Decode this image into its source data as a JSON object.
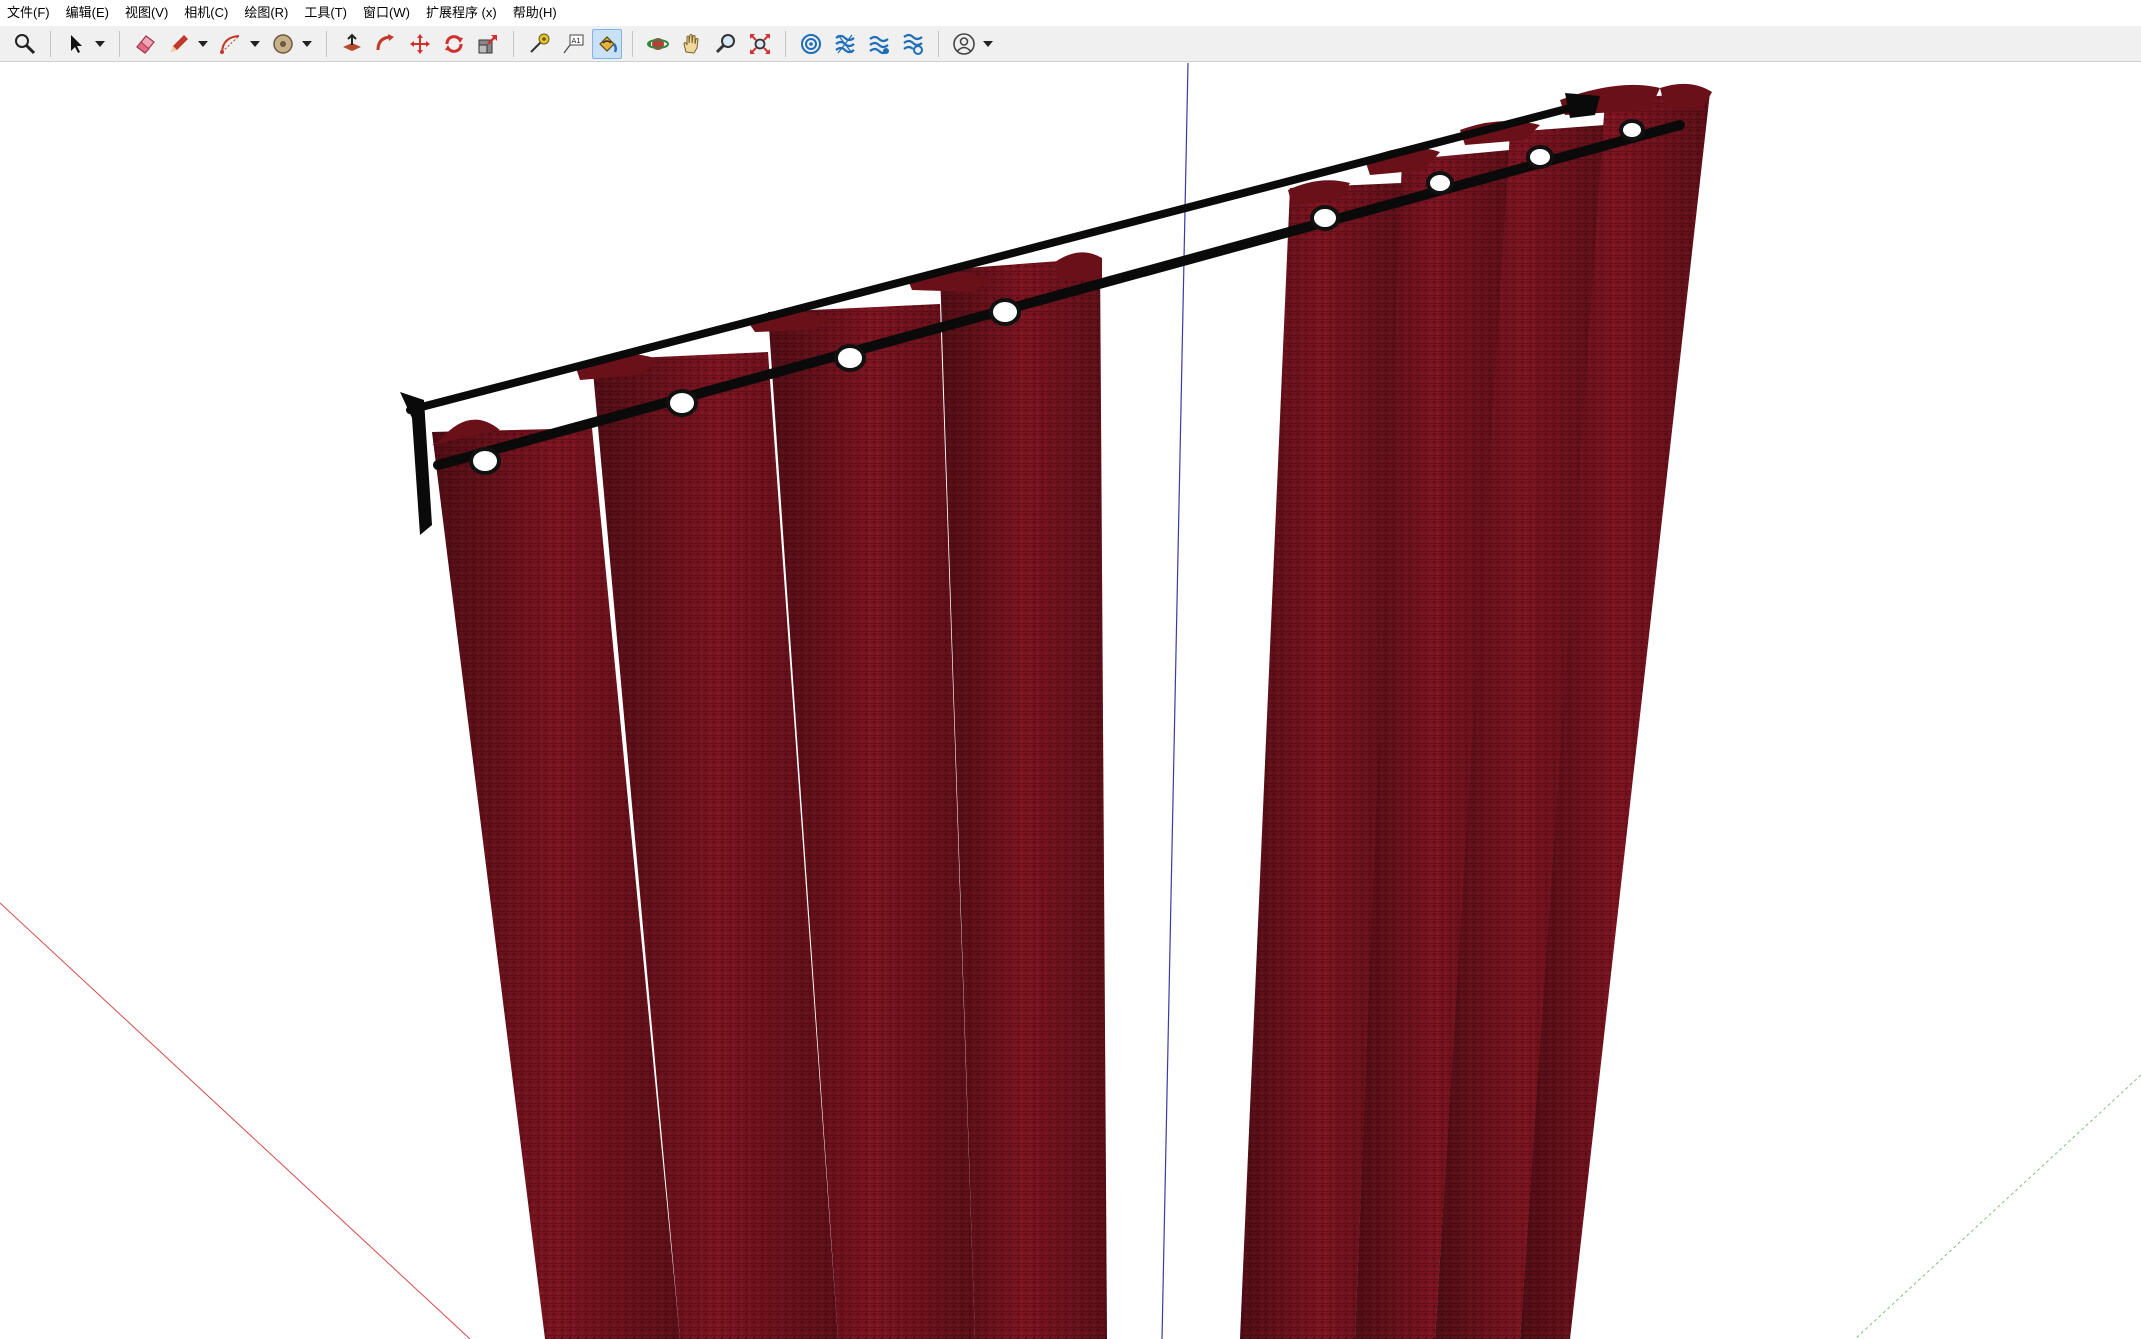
{
  "menubar": {
    "items": [
      {
        "label": "文件(F)"
      },
      {
        "label": "编辑(E)"
      },
      {
        "label": "视图(V)"
      },
      {
        "label": "相机(C)"
      },
      {
        "label": "绘图(R)"
      },
      {
        "label": "工具(T)"
      },
      {
        "label": "窗口(W)"
      },
      {
        "label": "扩展程序 (x)"
      },
      {
        "label": "帮助(H)"
      }
    ]
  },
  "toolbar": {
    "tools": [
      {
        "icon": "zoom-search-icon"
      },
      {
        "icon": "select-arrow-icon",
        "has_dropdown": true
      },
      {
        "icon": "eraser-icon"
      },
      {
        "icon": "pencil-line-icon",
        "has_dropdown": true
      },
      {
        "icon": "arc-icon",
        "has_dropdown": true
      },
      {
        "icon": "shape-circle-icon",
        "has_dropdown": true
      },
      {
        "icon": "push-pull-icon"
      },
      {
        "icon": "follow-me-icon"
      },
      {
        "icon": "move-icon"
      },
      {
        "icon": "rotate-icon"
      },
      {
        "icon": "scale-icon"
      },
      {
        "icon": "tape-measure-icon"
      },
      {
        "icon": "text-label-icon"
      },
      {
        "icon": "paint-bucket-icon",
        "active": true
      },
      {
        "icon": "orbit-icon"
      },
      {
        "icon": "pan-hand-icon"
      },
      {
        "icon": "zoom-icon"
      },
      {
        "icon": "zoom-extents-icon"
      },
      {
        "icon": "warehouse-icon"
      },
      {
        "icon": "extension-1-icon"
      },
      {
        "icon": "extension-2-icon"
      },
      {
        "icon": "extension-3-icon"
      },
      {
        "icon": "user-account-icon",
        "has_dropdown": true
      }
    ],
    "text_tool_glyph": "A1"
  },
  "viewport": {
    "background": "#ffffff",
    "curtain_color": "#7a1420",
    "rod_color": "#0a0a0a",
    "axis_colors": {
      "red": "#d94a4a",
      "green": "#7fbf7f",
      "blue": "#3a3aa8"
    }
  }
}
